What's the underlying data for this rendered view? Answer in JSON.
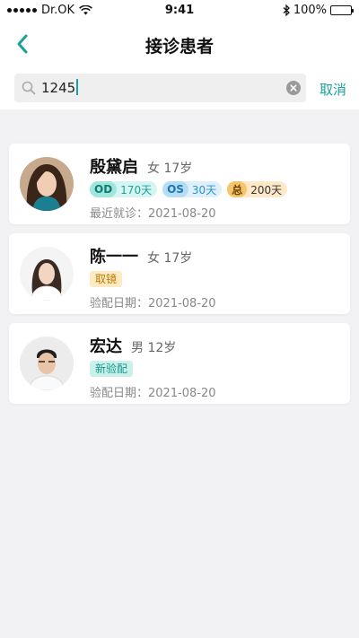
{
  "status_bar": {
    "carrier": "Dr.OK",
    "time": "9:41",
    "battery": "100%"
  },
  "nav": {
    "title": "接诊患者"
  },
  "search": {
    "query": "1245",
    "cancel_label": "取消"
  },
  "patients": [
    {
      "name": "殷黛启",
      "gender_age": "女 17岁",
      "tags": [
        {
          "key": "OD",
          "value": "170天"
        },
        {
          "key": "OS",
          "value": "30天"
        },
        {
          "key": "总",
          "value": "200天"
        }
      ],
      "date_label": "最近就诊：",
      "date": "2021-08-20"
    },
    {
      "name": "陈一一",
      "gender_age": "女 17岁",
      "status_tag": "取镜",
      "date_label": "验配日期：",
      "date": "2021-08-20"
    },
    {
      "name": "宏达",
      "gender_age": "男 12岁",
      "status_tag": "新验配",
      "date_label": "验配日期：",
      "date": "2021-08-20"
    }
  ],
  "colors": {
    "accent": "#1aa39a",
    "background": "#f2f2f4"
  }
}
